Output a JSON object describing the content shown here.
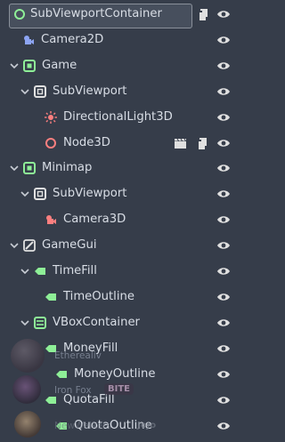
{
  "tree": {
    "nodes": [
      {
        "label": "SubViewportContainer",
        "icon": "control-container-icon",
        "expanded": true
      },
      {
        "label": "Camera2D",
        "icon": "camera2d-icon"
      },
      {
        "label": "Game",
        "icon": "subviewport-container-icon",
        "expanded": true
      },
      {
        "label": "SubViewport",
        "icon": "subviewport-icon",
        "expanded": true
      },
      {
        "label": "DirectionalLight3D",
        "icon": "directional-light-icon"
      },
      {
        "label": "Node3D",
        "icon": "node3d-icon"
      },
      {
        "label": "Minimap",
        "icon": "subviewport-container-icon",
        "expanded": true
      },
      {
        "label": "SubViewport",
        "icon": "subviewport-icon",
        "expanded": true
      },
      {
        "label": "Camera3D",
        "icon": "camera3d-icon"
      },
      {
        "label": "GameGui",
        "icon": "gui-icon",
        "expanded": true
      },
      {
        "label": "TimeFill",
        "icon": "label-icon",
        "expanded": true
      },
      {
        "label": "TimeOutline",
        "icon": "label-icon"
      },
      {
        "label": "VBoxContainer",
        "icon": "vbox-container-icon",
        "expanded": true
      },
      {
        "label": "MoneyFill",
        "icon": "label-icon"
      },
      {
        "label": "MoneyOutline",
        "icon": "label-icon"
      },
      {
        "label": "QuotaFill",
        "icon": "label-icon"
      },
      {
        "label": "QuotaOutline",
        "icon": "label-icon"
      }
    ]
  },
  "overlay": {
    "users": [
      {
        "name": "Etherealiv"
      },
      {
        "name": "Iron Fox",
        "badge": "BITE"
      },
      {
        "name": "NewWalkers",
        "badge": "JoJo"
      }
    ]
  },
  "colors": {
    "background": "#363d4a",
    "green_control": "#8eef97",
    "blue_2d": "#8da5f3",
    "red_3d": "#fc7f7f",
    "white_icon": "#e0e0e0"
  }
}
